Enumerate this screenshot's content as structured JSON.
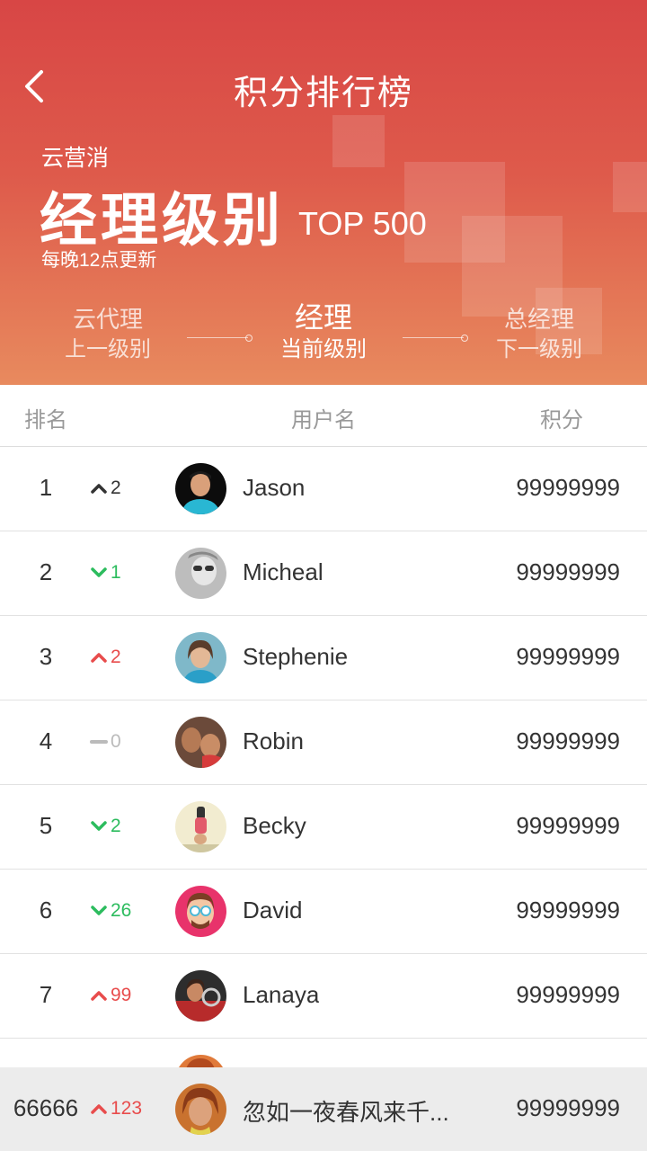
{
  "header": {
    "title": "积分排行榜",
    "brand": "云营消",
    "level": "经理级别",
    "top": "TOP 500",
    "update_note": "每晚12点更新",
    "colors": {
      "gradient_top": "#d84645",
      "gradient_bottom": "#e88a5e"
    }
  },
  "levels": {
    "prev": {
      "name": "云代理",
      "caption": "上一级别"
    },
    "current": {
      "name": "经理",
      "caption": "当前级别"
    },
    "next": {
      "name": "总经理",
      "caption": "下一级别"
    }
  },
  "columns": {
    "rank": "排名",
    "user": "用户名",
    "score": "积分"
  },
  "rows": [
    {
      "rank": "1",
      "trend": "up",
      "change": "2",
      "name": "Jason",
      "score": "99999999"
    },
    {
      "rank": "2",
      "trend": "down",
      "change": "1",
      "name": "Micheal",
      "score": "99999999"
    },
    {
      "rank": "3",
      "trend": "up",
      "change": "2",
      "name": "Stephenie",
      "score": "99999999"
    },
    {
      "rank": "4",
      "trend": "flat",
      "change": "0",
      "name": "Robin",
      "score": "99999999"
    },
    {
      "rank": "5",
      "trend": "down",
      "change": "2",
      "name": "Becky",
      "score": "99999999"
    },
    {
      "rank": "6",
      "trend": "down",
      "change": "26",
      "name": "David",
      "score": "99999999"
    },
    {
      "rank": "7",
      "trend": "up",
      "change": "99",
      "name": "Lanaya",
      "score": "99999999"
    },
    {
      "rank": "",
      "trend": "none",
      "change": "",
      "name": "",
      "score": ""
    }
  ],
  "me": {
    "rank": "66666",
    "trend": "up",
    "change": "123",
    "name": "忽如一夜春风来千...",
    "score": "99999999"
  },
  "colors": {
    "up": "#e84c4c",
    "down": "#2cbc5e",
    "flat": "#bbbbbb"
  }
}
